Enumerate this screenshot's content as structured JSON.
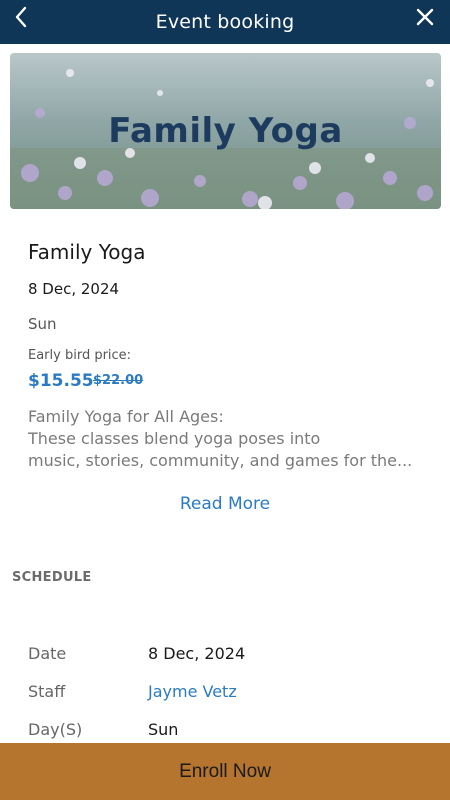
{
  "header": {
    "title": "Event booking",
    "back_icon": "chevron-left-icon",
    "close_icon": "close-icon",
    "background": "#0f3557"
  },
  "hero": {
    "title": "Family Yoga"
  },
  "event": {
    "name": "Family Yoga",
    "date": "8 Dec, 2024",
    "day": "Sun",
    "early_bird_label": "Early bird price:",
    "price": "$15.55",
    "original_price": "$22.00",
    "description_lines": [
      "Family Yoga for All Ages:",
      "These classes blend yoga poses into",
      "music, stories, community, and games for the..."
    ],
    "read_more": "Read More"
  },
  "schedule": {
    "title": "SCHEDULE",
    "rows": [
      {
        "label": "Date",
        "value": "8 Dec, 2024"
      },
      {
        "label": "Staff",
        "value": "Jayme Vetz"
      },
      {
        "label": "Day(S)",
        "value": "Sun"
      }
    ]
  },
  "footer": {
    "enroll_label": "Enroll Now",
    "background": "#b5752f"
  },
  "colors": {
    "accent": "#2a7bc4"
  }
}
